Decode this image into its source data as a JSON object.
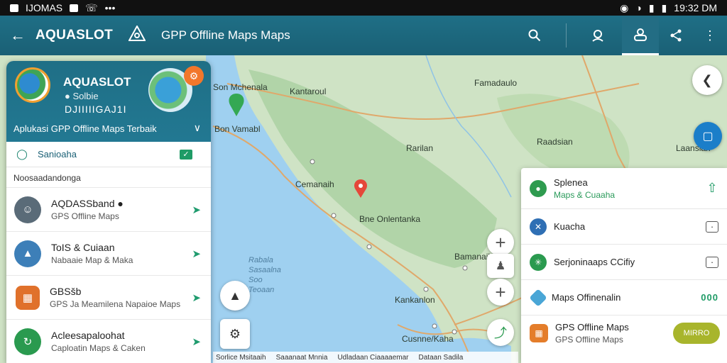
{
  "status_bar": {
    "left_text": "IJOMAS",
    "time": "19:32 DM"
  },
  "app_bar": {
    "title": "AQUASLOT",
    "subtitle": "GPP Offline Maps Maps",
    "icons": [
      "back-arrow-icon",
      "logo-icon",
      "search-icon",
      "user-location-icon",
      "layers-icon",
      "share-icon",
      "more-vert-icon"
    ]
  },
  "map": {
    "labels": [
      {
        "id": "l1",
        "text": "Son Mchenala"
      },
      {
        "id": "l2",
        "text": "Kantaroul"
      },
      {
        "id": "l3",
        "text": "Famadaulo"
      },
      {
        "id": "l4",
        "text": "Bon Vamabl"
      },
      {
        "id": "l5",
        "text": "Rarilan"
      },
      {
        "id": "l6",
        "text": "Cemanaih"
      },
      {
        "id": "l7",
        "text": "Bne Onlentanka"
      },
      {
        "id": "l8",
        "text": "Bamanaih"
      },
      {
        "id": "l9",
        "text": "Kankanlon"
      },
      {
        "id": "l10",
        "text": "Cusnne/Kaha"
      },
      {
        "id": "l11",
        "text": "Laanslan"
      },
      {
        "id": "l12",
        "text": "Raadsian"
      }
    ],
    "sea_label": "Rabala\nSasaalna\nSoo\nTeoaan",
    "scale_bar": [
      "Sorlice Msitaaih",
      "Saaanaat Mnnia",
      "Udladaan Ciaaaaemar",
      "Dataan Sadila"
    ]
  },
  "left_panel": {
    "header": {
      "name": "AQUASLOT",
      "sub1": "● Solbie",
      "sub2": "DJIIIIIGAJ1I",
      "description": "Aplukasi GPP Offline Maps Terbaik"
    },
    "tab_label": "Sanioaha",
    "section_title": "Noosaadandonga",
    "items": [
      {
        "title": "AQDASSband ●",
        "subtitle": "GPS Offline Maps",
        "color": "#5a6b78"
      },
      {
        "title": "ToIS & Cuiaan",
        "subtitle": "Nabaaie Map & Maka",
        "color": "#3d7fb8"
      },
      {
        "title": "GBSšb",
        "subtitle": "GPS Ja Meamilena Napaioe Maps",
        "color": "#e0712b"
      },
      {
        "title": "Acleesapaloohat",
        "subtitle": "Caploatin Maps & Caken",
        "color": "#2a9a4f"
      }
    ]
  },
  "right_panel": {
    "items": [
      {
        "title": "Splenea",
        "subtitle": "Maps & Cuaaha",
        "icon_color": "#2e9b4f",
        "subtitle_style": "green"
      },
      {
        "title": "Kuacha",
        "subtitle": "",
        "icon_color": "#2f6fb4"
      },
      {
        "title": "Serjoninaaps CCifiy",
        "subtitle": "",
        "icon_color": "#2a9a4f"
      },
      {
        "title": "Maps Offinenalin",
        "subtitle": "",
        "icon_color": "#4aa6d6",
        "action": "000"
      },
      {
        "title": "GPS Offline Maps",
        "subtitle": "GPS Offline Maps",
        "icon_color": "#e47d2a",
        "subtitle_style": "gray",
        "pill": "MIRRO"
      }
    ]
  },
  "colors": {
    "app_bar": "#1f6f86",
    "accent_green": "#1f9b66",
    "pin_red": "#e5483a",
    "pin_green": "#34a853",
    "water": "#9fd0f0",
    "land": "#cfe3c5"
  }
}
